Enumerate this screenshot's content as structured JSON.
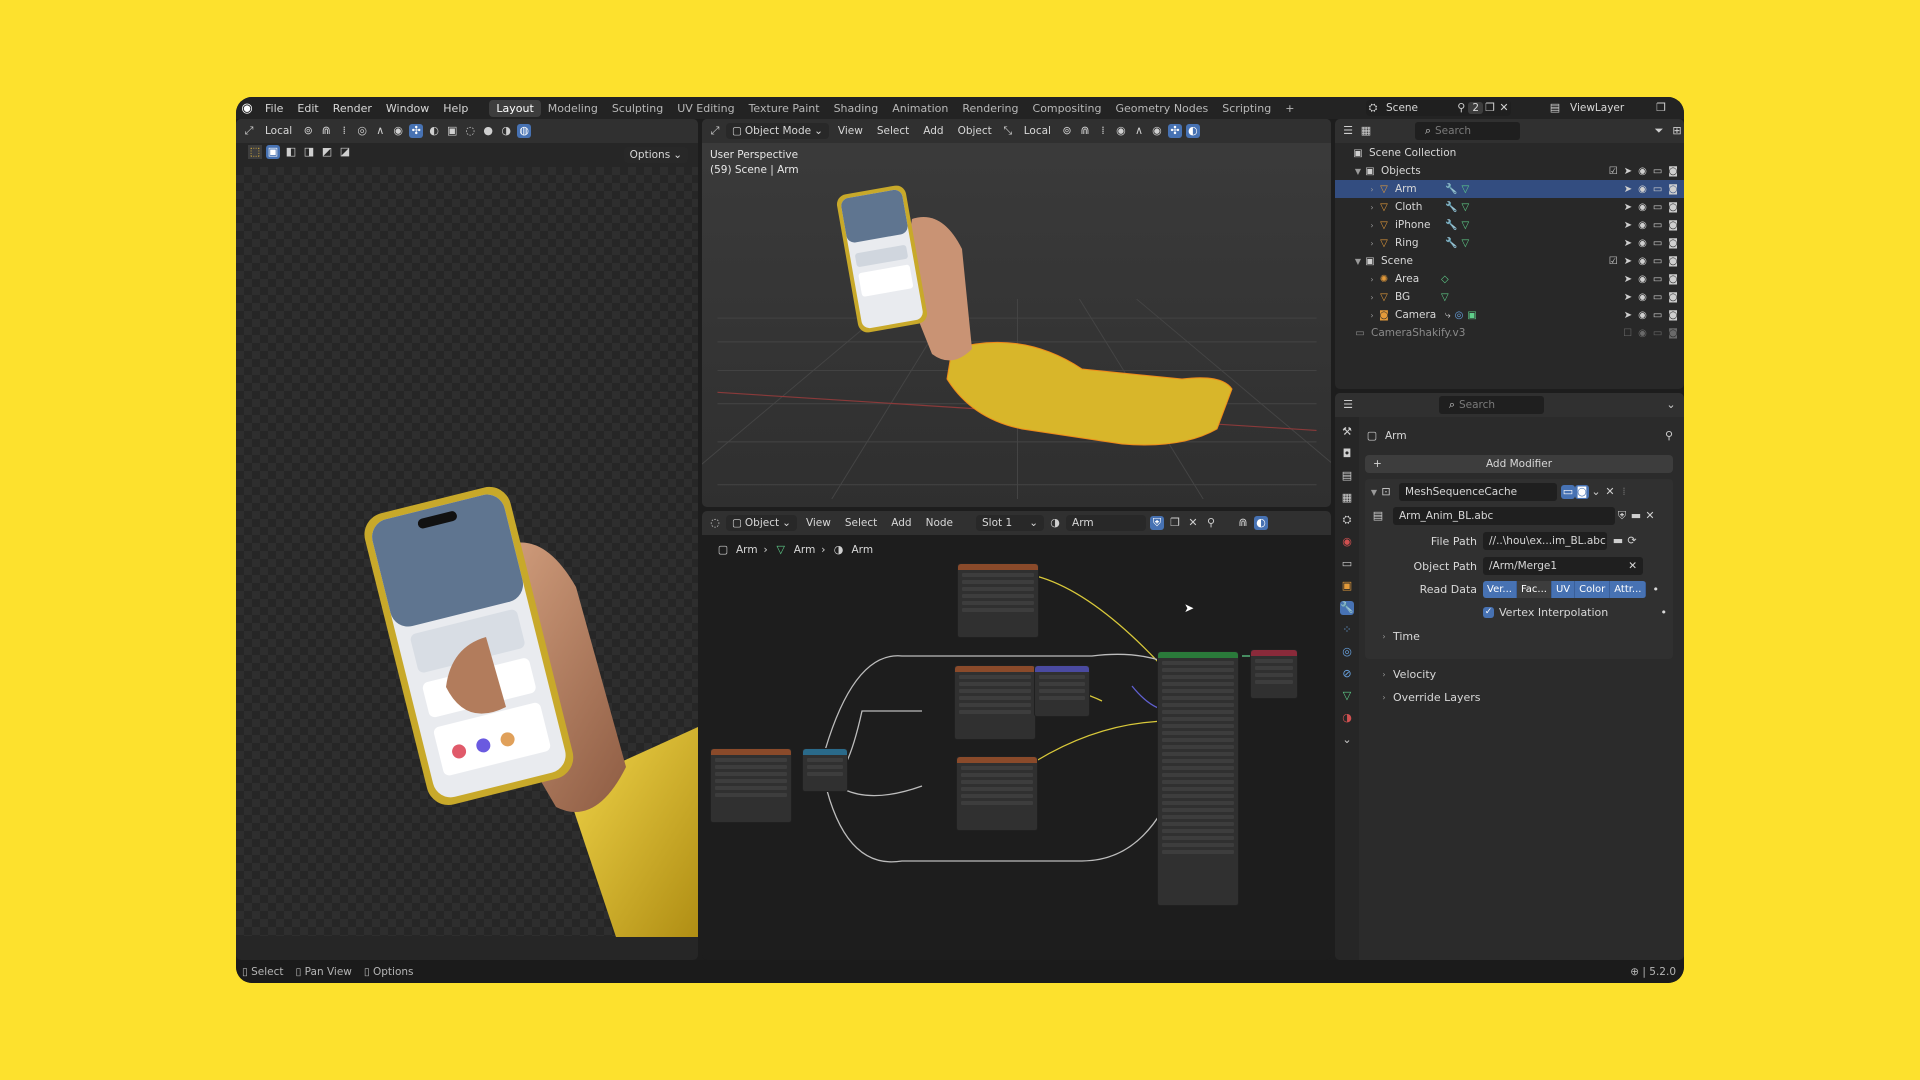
{
  "topbar": {
    "menu": [
      "File",
      "Edit",
      "Render",
      "Window",
      "Help"
    ],
    "workspaces": [
      "Layout",
      "Modeling",
      "Sculpting",
      "UV Editing",
      "Texture Paint",
      "Shading",
      "Animation",
      "Rendering",
      "Compositing",
      "Geometry Nodes",
      "Scripting"
    ],
    "active_workspace": "Layout",
    "add_workspace": "+",
    "scene": "Scene",
    "scene_count": "2",
    "view_layer": "ViewLayer"
  },
  "left_view": {
    "transform": "Local",
    "options": "Options"
  },
  "viewport": {
    "mode": "Object Mode",
    "menus": [
      "View",
      "Select",
      "Add",
      "Object"
    ],
    "transform": "Local",
    "overlay_title": "User Perspective",
    "overlay_subtitle": "(59) Scene | Arm"
  },
  "node_editor": {
    "type": "Object",
    "menus": [
      "View",
      "Select",
      "Add",
      "Node"
    ],
    "slot": "Slot 1",
    "material": "Arm",
    "breadcrumb": [
      "Arm",
      "Arm",
      "Arm"
    ]
  },
  "outliner": {
    "search_placeholder": "Search",
    "root": "Scene Collection",
    "rows": [
      {
        "label": "Objects",
        "kind": "collection"
      },
      {
        "label": "Arm",
        "kind": "object"
      },
      {
        "label": "Cloth",
        "kind": "object"
      },
      {
        "label": "iPhone",
        "kind": "object"
      },
      {
        "label": "Ring",
        "kind": "object"
      },
      {
        "label": "Scene",
        "kind": "collection"
      },
      {
        "label": "Area",
        "kind": "light"
      },
      {
        "label": "BG",
        "kind": "object"
      },
      {
        "label": "Camera",
        "kind": "camera"
      },
      {
        "label": "CameraShakify.v3",
        "kind": "action"
      }
    ]
  },
  "properties": {
    "search_placeholder": "Search",
    "object_name": "Arm",
    "add_modifier": "Add Modifier",
    "modifier_name": "MeshSequenceCache",
    "cache_file": "Arm_Anim_BL.abc",
    "file_path_label": "File Path",
    "file_path_value": "//..\\hou\\ex...im_BL.abc",
    "object_path_label": "Object Path",
    "object_path_value": "/Arm/Merge1",
    "read_data_label": "Read Data",
    "read_data_options": [
      "Ver...",
      "Fac...",
      "UV",
      "Color",
      "Attr..."
    ],
    "vertex_interp": "Vertex Interpolation",
    "sections": [
      "Time",
      "Velocity",
      "Override Layers"
    ]
  },
  "status_bar": {
    "items": [
      "Select",
      "Pan View",
      "Options"
    ],
    "version": "5.2.0"
  },
  "colors": {
    "background": "#fde12d",
    "accent": "#4772b3",
    "selected_row": "#334d80"
  }
}
